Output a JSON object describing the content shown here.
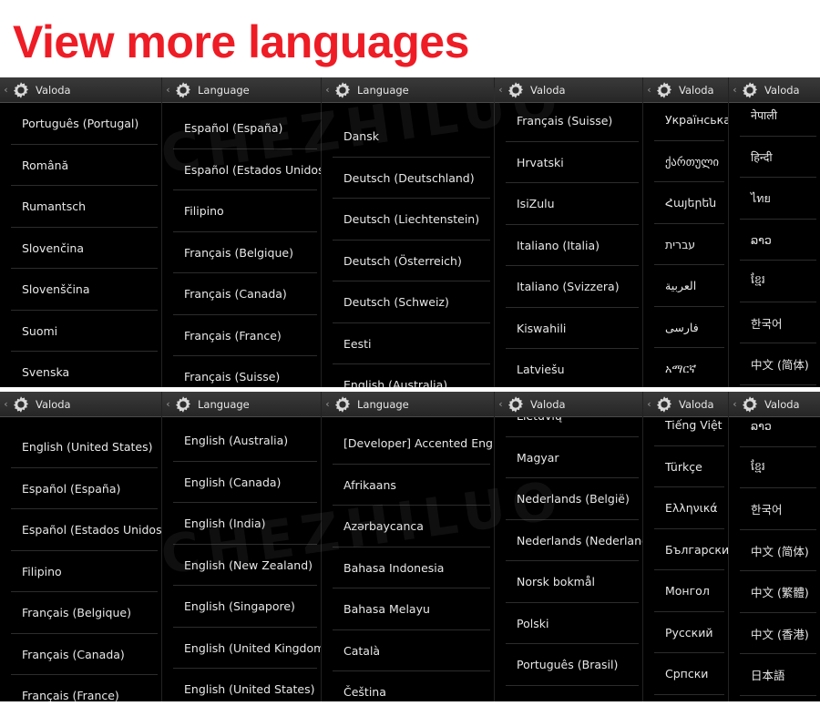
{
  "headline": "View more languages",
  "rows": [
    {
      "panels": [
        {
          "title": "Valoda",
          "items": [
            "Português (Portugal)",
            "Română",
            "Rumantsch",
            "Slovenčina",
            "Slovenščina",
            "Suomi",
            "Svenska"
          ]
        },
        {
          "title": "Language",
          "items": [
            "Español (España)",
            "Español (Estados Unidos)",
            "Filipino",
            "Français (Belgique)",
            "Français (Canada)",
            "Français (France)",
            "Français (Suisse)"
          ]
        },
        {
          "title": "Language",
          "items": [
            "Dansk",
            "Deutsch (Deutschland)",
            "Deutsch (Liechtenstein)",
            "Deutsch (Österreich)",
            "Deutsch (Schweiz)",
            "Eesti",
            "English (Australia)"
          ]
        },
        {
          "title": "Valoda",
          "items": [
            "Français (Suisse)",
            "Hrvatski",
            "IsiZulu",
            "Italiano (Italia)",
            "Italiano (Svizzera)",
            "Kiswahili",
            "Latviešu"
          ]
        },
        {
          "title": "Valoda",
          "items": [
            "Українська",
            "ქართული",
            "Հայերեն",
            "עברית",
            "العربية",
            "فارسی",
            "አማርኛ"
          ]
        },
        {
          "title": "Valoda",
          "items": [
            "नेपाली",
            "हिन्दी",
            "ไทย",
            "ລາວ",
            "ខ្មែរ",
            "한국어",
            "中文 (简体)"
          ]
        }
      ]
    },
    {
      "panels": [
        {
          "title": "Valoda",
          "items": [
            "English (United States)",
            "Español (España)",
            "Español (Estados Unidos)",
            "Filipino",
            "Français (Belgique)",
            "Français (Canada)",
            "Français (France)"
          ]
        },
        {
          "title": "Language",
          "items": [
            "English (Australia)",
            "English (Canada)",
            "English (India)",
            "English (New Zealand)",
            "English (Singapore)",
            "English (United Kingdom)",
            "English (United States)"
          ]
        },
        {
          "title": "Language",
          "items": [
            "[Developer] Accented English",
            "Afrikaans",
            "Azərbaycanca",
            "Bahasa Indonesia",
            "Bahasa Melayu",
            "Català",
            "Čeština"
          ]
        },
        {
          "title": "Valoda",
          "items": [
            "Lietuvių",
            "Magyar",
            "Nederlands (België)",
            "Nederlands (Nederland)",
            "Norsk bokmål",
            "Polski",
            "Português (Brasil)"
          ]
        },
        {
          "title": "Valoda",
          "items": [
            "Tiếng Việt",
            "Türkçe",
            "Ελληνικά",
            "Български",
            "Монгол",
            "Русский",
            "Српски"
          ]
        },
        {
          "title": "Valoda",
          "items": [
            "ລາວ",
            "ខ្មែរ",
            "한국어",
            "中文 (简体)",
            "中文 (繁體)",
            "中文 (香港)",
            "日本語"
          ]
        }
      ]
    }
  ]
}
